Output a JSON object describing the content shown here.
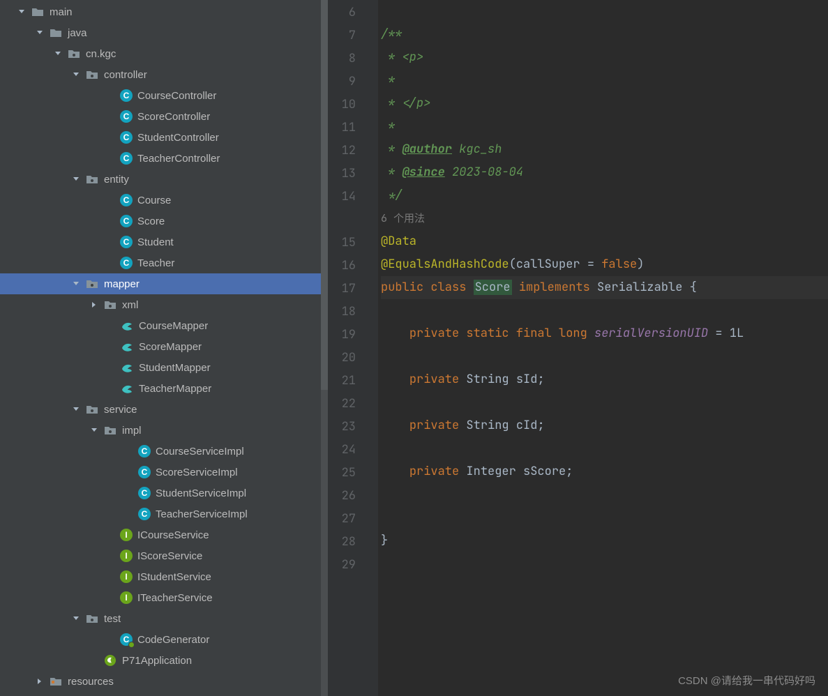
{
  "tree": {
    "main": "main",
    "java": "java",
    "pkg": "cn.kgc",
    "controller": {
      "label": "controller",
      "items": [
        "CourseController",
        "ScoreController",
        "StudentController",
        "TeacherController"
      ]
    },
    "entity": {
      "label": "entity",
      "items": [
        "Course",
        "Score",
        "Student",
        "Teacher"
      ]
    },
    "mapper": {
      "label": "mapper",
      "xml": "xml",
      "items": [
        "CourseMapper",
        "ScoreMapper",
        "StudentMapper",
        "TeacherMapper"
      ]
    },
    "service": {
      "label": "service",
      "impl": {
        "label": "impl",
        "items": [
          "CourseServiceImpl",
          "ScoreServiceImpl",
          "StudentServiceImpl",
          "TeacherServiceImpl"
        ]
      },
      "ifaces": [
        "ICourseService",
        "IScoreService",
        "IStudentService",
        "ITeacherService"
      ]
    },
    "test": {
      "label": "test",
      "items": [
        "CodeGenerator"
      ]
    },
    "app": "P71Application",
    "resources": "resources"
  },
  "editor": {
    "usage_hint": "6 个用法",
    "lines": [
      6,
      7,
      8,
      9,
      10,
      11,
      12,
      13,
      14,
      15,
      16,
      17,
      18,
      19,
      20,
      21,
      22,
      23,
      24,
      25,
      26,
      27,
      28,
      29
    ],
    "doc": {
      "start": "/**",
      "p_open": " * <p>",
      "blank1": " *",
      "p_close": " * </p>",
      "blank2": " *",
      "author_tag": "@author",
      "author_val": " kgc_sh",
      "since_tag": "@since",
      "since_val": " 2023-08-04",
      "end": " */"
    },
    "annot_data": "@Data",
    "annot_ehc": "@EqualsAndHashCode",
    "annot_arg_key": "callSuper",
    "annot_arg_val": "false",
    "decl": {
      "public": "public",
      "class": "class",
      "name": "Score",
      "implements": "implements",
      "iface": "Serializable",
      "open": " {"
    },
    "fields": [
      {
        "mods": "private static final",
        "type": "long",
        "name": "serialVersionUID",
        "rest": " = 1L"
      },
      {
        "mods": "private",
        "type": "String",
        "name": "sId",
        "rest": ";"
      },
      {
        "mods": "private",
        "type": "String",
        "name": "cId",
        "rest": ";"
      },
      {
        "mods": "private",
        "type": "Integer",
        "name": "sScore",
        "rest": ";"
      }
    ],
    "close": "}"
  },
  "watermark": "CSDN @请给我一串代码好吗"
}
